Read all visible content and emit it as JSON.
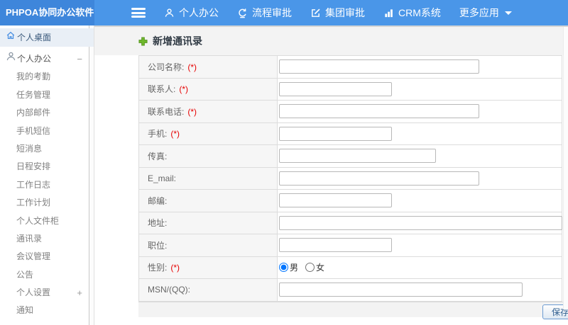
{
  "header": {
    "logo": "PHPOA协同办公软件",
    "hamburger_icon": "menu-icon",
    "nav_items": [
      {
        "label": "个人办公",
        "icon": "user-icon"
      },
      {
        "label": "流程审批",
        "icon": "cycle-icon"
      },
      {
        "label": "集团审批",
        "icon": "edit-icon"
      },
      {
        "label": "CRM系统",
        "icon": "bar-chart-icon"
      },
      {
        "label": "更多应用",
        "icon": "caret-down-icon"
      }
    ]
  },
  "sidebar": {
    "items": [
      {
        "label": "个人桌面",
        "icon": "home-icon",
        "active": true,
        "level": 0
      },
      {
        "label": "个人办公",
        "icon": "user-icon",
        "expander": "−",
        "level": 0
      },
      {
        "label": "我的考勤",
        "level": 1
      },
      {
        "label": "任务管理",
        "level": 1
      },
      {
        "label": "内部邮件",
        "level": 1
      },
      {
        "label": "手机短信",
        "level": 1
      },
      {
        "label": "短消息",
        "level": 1
      },
      {
        "label": "日程安排",
        "level": 1
      },
      {
        "label": "工作日志",
        "level": 1
      },
      {
        "label": "工作计划",
        "level": 1
      },
      {
        "label": "个人文件柜",
        "level": 1
      },
      {
        "label": "通讯录",
        "level": 1
      },
      {
        "label": "会议管理",
        "level": 1
      },
      {
        "label": "公告",
        "level": 1
      },
      {
        "label": "个人设置",
        "level": 1,
        "expander": "+"
      },
      {
        "label": "通知",
        "level": 1
      }
    ]
  },
  "main": {
    "title": "新增通讯录",
    "title_icon": "add-plus-icon",
    "form_rows": [
      {
        "label": "公司名称:",
        "required": "(*)",
        "type": "text",
        "input_width": 282
      },
      {
        "label": "联系人:",
        "required": "(*)",
        "type": "text",
        "input_width": 159
      },
      {
        "label": "联系电话:",
        "required": "(*)",
        "type": "text",
        "input_width": 282
      },
      {
        "label": "手机:",
        "required": "(*)",
        "type": "text",
        "input_width": 159
      },
      {
        "label": "传真:",
        "type": "text",
        "input_width": 221
      },
      {
        "label": "E_mail:",
        "type": "text",
        "input_width": 282
      },
      {
        "label": "邮编:",
        "type": "text",
        "input_width": 159
      },
      {
        "label": "地址:",
        "type": "text",
        "input_width": 399
      },
      {
        "label": "职位:",
        "type": "text",
        "input_width": 159
      },
      {
        "label": "性别:",
        "required": "(*)",
        "type": "radio",
        "options": [
          {
            "label": "男",
            "checked": true
          },
          {
            "label": "女",
            "checked": false
          }
        ]
      },
      {
        "label": "MSN/(QQ):",
        "type": "text",
        "input_width": 343
      }
    ],
    "save_button": "保存"
  },
  "colors": {
    "header_bg": "#4a96e8",
    "logo_bg": "#3e86db",
    "required_mark": "#e60000",
    "title_plus_green": "#6fb82c",
    "active_item_bg": "#e9eff6"
  }
}
